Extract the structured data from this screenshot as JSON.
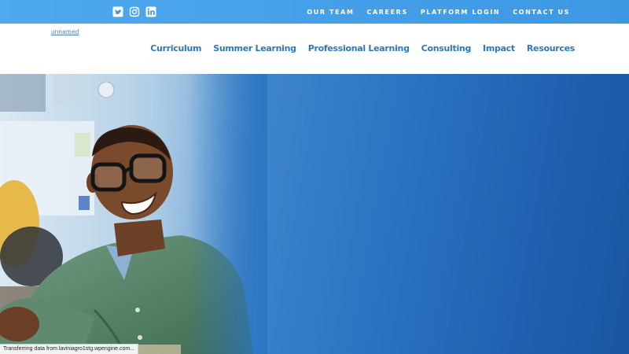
{
  "topbar": {
    "social": [
      {
        "icon": "twitter-icon"
      },
      {
        "icon": "instagram-icon"
      },
      {
        "icon": "linkedin-icon"
      }
    ],
    "links": [
      "OUR TEAM",
      "CAREERS",
      "PLATFORM LOGIN",
      "CONTACT US"
    ]
  },
  "header": {
    "logo_alt": "unnamed",
    "nav": [
      "Curriculum",
      "Summer Learning",
      "Professional Learning",
      "Consulting",
      "Impact",
      "Resources"
    ]
  },
  "status": {
    "text": "Transferring data from laviniagro1stg.wpengine.com..."
  },
  "colors": {
    "topbar": "#4ea9ee",
    "nav_text": "#2c78b8",
    "hero_blue": "#2b74c1"
  }
}
